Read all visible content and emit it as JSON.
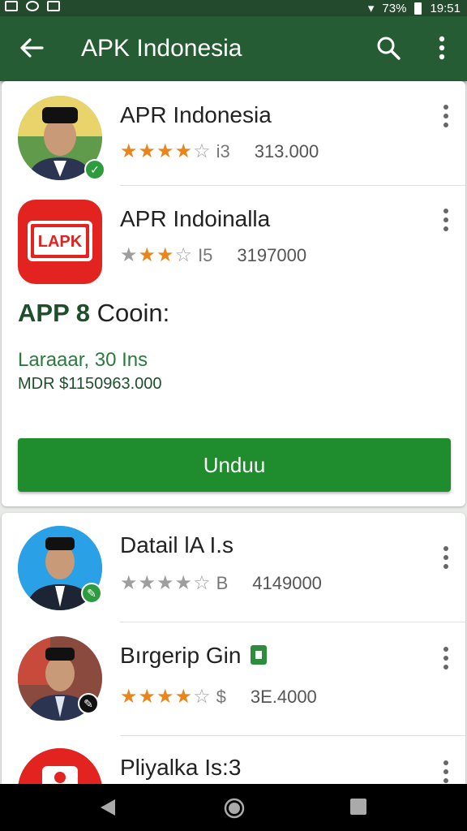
{
  "statusbar": {
    "battery": "73%",
    "time": "19:51"
  },
  "appbar": {
    "title": "APK Indonesia"
  },
  "icons": {
    "back": "arrow-left-icon",
    "search": "search-icon",
    "more": "more-vert-icon"
  },
  "apps": [
    {
      "title": "APR Indonesia",
      "stars_filled": 4,
      "rating": "i3",
      "downloads": "313.000"
    },
    {
      "title": "APR Indoinalla",
      "stars_filled": 3,
      "rating": "I5",
      "downloads": "3197000",
      "icon_text": "LAPK"
    }
  ],
  "promo": {
    "title_bold": "APP 8",
    "title_rest": "Cooin:",
    "line1": "Laraaar, 30 Ins",
    "line2": "MDR $1150963.000",
    "button": "Unduu"
  },
  "apps2": [
    {
      "title": "Datail lA I.s",
      "stars_filled": 4,
      "rating": "B",
      "downloads": "4149000"
    },
    {
      "title": "Bırgerip Gin",
      "stars_filled": 4,
      "rating": "$",
      "downloads": "3E.4000"
    },
    {
      "title": "Pliyalka Is:3"
    }
  ],
  "colors": {
    "appbar": "#255c34",
    "button": "#1f8c2e",
    "star": "#e8861d",
    "promo": "#1e4f2b"
  }
}
